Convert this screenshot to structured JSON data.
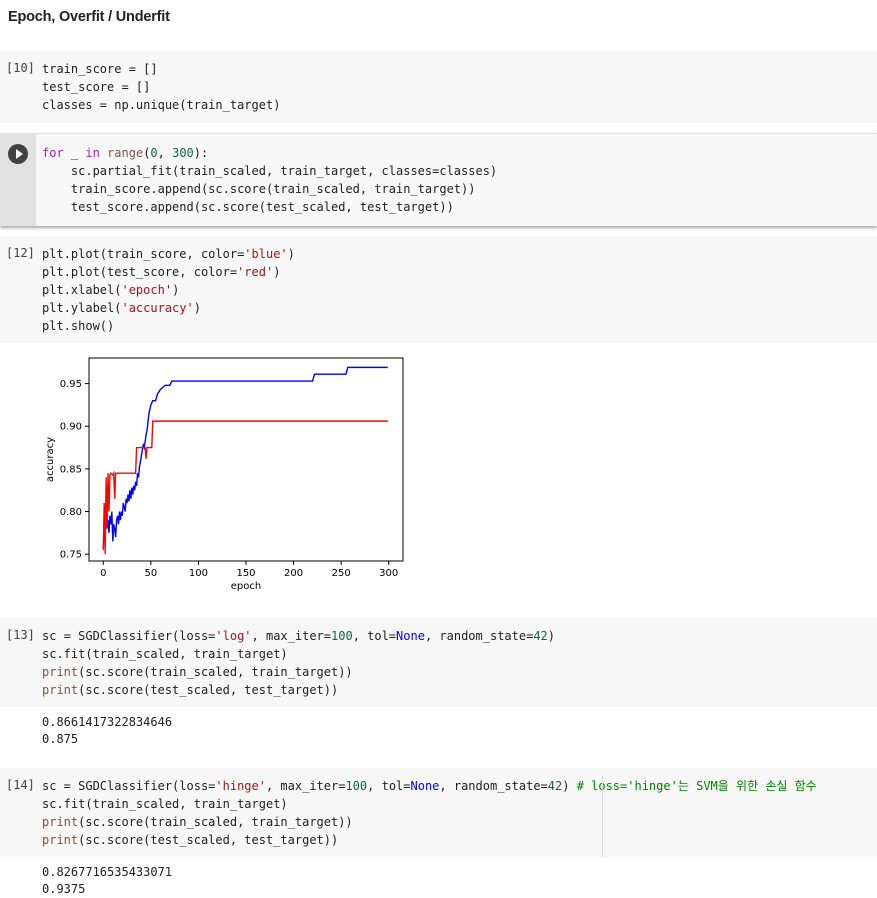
{
  "section_title": "Epoch, Overfit / Underfit",
  "cells": [
    {
      "prompt": "[10]",
      "code": [
        [
          [
            "train_score = []",
            "p"
          ]
        ],
        [
          [
            "test_score = []",
            "p"
          ]
        ],
        [
          [
            "classes = np.unique(train_target)",
            "p"
          ]
        ]
      ]
    },
    {
      "prompt": "",
      "code": [
        [
          [
            "for",
            "kw"
          ],
          [
            " _ ",
            "p"
          ],
          [
            "in",
            "kw"
          ],
          [
            " ",
            "p"
          ],
          [
            "range",
            "fn"
          ],
          [
            "(",
            "p"
          ],
          [
            "0",
            "num"
          ],
          [
            ", ",
            "p"
          ],
          [
            "300",
            "num"
          ],
          [
            "):",
            "p"
          ]
        ],
        [
          [
            "    sc.partial_fit(train_scaled, train_target, classes=classes)",
            "p"
          ]
        ],
        [
          [
            "    train_score.append(sc.score(train_scaled, train_target))",
            "p"
          ]
        ],
        [
          [
            "    test_score.append(sc.score(test_scaled, test_target))",
            "p"
          ]
        ]
      ]
    },
    {
      "prompt": "[12]",
      "code": [
        [
          [
            "plt.plot(train_score, color=",
            "p"
          ],
          [
            "'blue'",
            "str"
          ],
          [
            ")",
            "p"
          ]
        ],
        [
          [
            "plt.plot(test_score, color=",
            "p"
          ],
          [
            "'red'",
            "str"
          ],
          [
            ")",
            "p"
          ]
        ],
        [
          [
            "plt.xlabel(",
            "p"
          ],
          [
            "'epoch'",
            "str"
          ],
          [
            ")",
            "p"
          ]
        ],
        [
          [
            "plt.ylabel(",
            "p"
          ],
          [
            "'accuracy'",
            "str"
          ],
          [
            ")",
            "p"
          ]
        ],
        [
          [
            "plt.show()",
            "p"
          ]
        ]
      ]
    },
    {
      "prompt": "[13]",
      "code": [
        [
          [
            "sc = SGDClassifier(loss=",
            "p"
          ],
          [
            "'log'",
            "str"
          ],
          [
            ", max_iter=",
            "p"
          ],
          [
            "100",
            "num"
          ],
          [
            ", tol=",
            "p"
          ],
          [
            "None",
            "blu"
          ],
          [
            ", random_state=",
            "p"
          ],
          [
            "42",
            "num"
          ],
          [
            ")",
            "p"
          ]
        ],
        [
          [
            "sc.fit(train_scaled, train_target)",
            "p"
          ]
        ],
        [
          [
            "print",
            "fn"
          ],
          [
            "(sc.score(train_scaled, train_target))",
            "p"
          ]
        ],
        [
          [
            "print",
            "fn"
          ],
          [
            "(sc.score(test_scaled, test_target))",
            "p"
          ]
        ]
      ],
      "output": [
        "0.8661417322834646",
        "0.875"
      ]
    },
    {
      "prompt": "[14]",
      "code": [
        [
          [
            "sc = SGDClassifier(loss=",
            "p"
          ],
          [
            "'hinge'",
            "str"
          ],
          [
            ", max_iter=",
            "p"
          ],
          [
            "100",
            "num"
          ],
          [
            ", tol=",
            "p"
          ],
          [
            "None",
            "blu"
          ],
          [
            ", random_state=",
            "p"
          ],
          [
            "42",
            "num"
          ],
          [
            ") ",
            "p"
          ],
          [
            "# loss='hinge'는 SVM을 위한 손실 함수",
            "cmt"
          ]
        ],
        [
          [
            "sc.fit(train_scaled, train_target)",
            "p"
          ]
        ],
        [
          [
            "print",
            "fn"
          ],
          [
            "(sc.score(train_scaled, train_target))",
            "p"
          ]
        ],
        [
          [
            "print",
            "fn"
          ],
          [
            "(sc.score(test_scaled, test_target))",
            "p"
          ]
        ]
      ],
      "output": [
        "0.8267716535433071",
        "0.9375"
      ]
    }
  ],
  "chart_data": {
    "type": "line",
    "xlabel": "epoch",
    "ylabel": "accuracy",
    "xlim": [
      -15,
      315
    ],
    "ylim": [
      0.742,
      0.98
    ],
    "xticks": [
      0,
      50,
      100,
      150,
      200,
      250,
      300
    ],
    "yticks": [
      0.75,
      0.8,
      0.85,
      0.9,
      0.95
    ],
    "grid": false,
    "series": [
      {
        "color": "#0000ff",
        "points": [
          [
            0,
            0.756
          ],
          [
            1,
            0.79
          ],
          [
            2,
            0.77
          ],
          [
            3,
            0.8
          ],
          [
            4,
            0.78
          ],
          [
            5,
            0.79
          ],
          [
            6,
            0.775
          ],
          [
            7,
            0.795
          ],
          [
            8,
            0.785
          ],
          [
            9,
            0.8
          ],
          [
            10,
            0.765
          ],
          [
            11,
            0.785
          ],
          [
            12,
            0.78
          ],
          [
            13,
            0.77
          ],
          [
            14,
            0.79
          ],
          [
            15,
            0.795
          ],
          [
            16,
            0.785
          ],
          [
            17,
            0.8
          ],
          [
            18,
            0.79
          ],
          [
            19,
            0.8
          ],
          [
            20,
            0.795
          ],
          [
            21,
            0.81
          ],
          [
            22,
            0.805
          ],
          [
            23,
            0.8
          ],
          [
            24,
            0.815
          ],
          [
            25,
            0.81
          ],
          [
            26,
            0.82
          ],
          [
            27,
            0.812
          ],
          [
            28,
            0.825
          ],
          [
            29,
            0.815
          ],
          [
            30,
            0.828
          ],
          [
            31,
            0.82
          ],
          [
            32,
            0.83
          ],
          [
            33,
            0.825
          ],
          [
            34,
            0.835
          ],
          [
            35,
            0.83
          ],
          [
            36,
            0.845
          ],
          [
            37,
            0.84
          ],
          [
            38,
            0.852
          ],
          [
            39,
            0.858
          ],
          [
            40,
            0.865
          ],
          [
            41,
            0.872
          ],
          [
            42,
            0.878
          ],
          [
            43,
            0.875
          ],
          [
            44,
            0.882
          ],
          [
            45,
            0.89
          ],
          [
            46,
            0.895
          ],
          [
            47,
            0.905
          ],
          [
            48,
            0.915
          ],
          [
            49,
            0.92
          ],
          [
            50,
            0.925
          ],
          [
            52,
            0.93
          ],
          [
            55,
            0.93
          ],
          [
            57,
            0.938
          ],
          [
            60,
            0.943
          ],
          [
            65,
            0.948
          ],
          [
            70,
            0.948
          ],
          [
            72,
            0.953
          ],
          [
            220,
            0.953
          ],
          [
            222,
            0.961
          ],
          [
            255,
            0.961
          ],
          [
            257,
            0.969
          ],
          [
            299,
            0.969
          ]
        ]
      },
      {
        "color": "#ff0000",
        "points": [
          [
            0,
            0.755
          ],
          [
            1,
            0.81
          ],
          [
            2,
            0.75
          ],
          [
            3,
            0.84
          ],
          [
            4,
            0.78
          ],
          [
            5,
            0.845
          ],
          [
            6,
            0.8
          ],
          [
            7,
            0.843
          ],
          [
            8,
            0.845
          ],
          [
            10,
            0.843
          ],
          [
            11,
            0.845
          ],
          [
            12,
            0.815
          ],
          [
            13,
            0.845
          ],
          [
            34,
            0.845
          ],
          [
            35,
            0.875
          ],
          [
            44,
            0.875
          ],
          [
            45,
            0.862
          ],
          [
            46,
            0.875
          ],
          [
            51,
            0.875
          ],
          [
            52,
            0.906
          ],
          [
            299,
            0.906
          ]
        ]
      }
    ]
  }
}
